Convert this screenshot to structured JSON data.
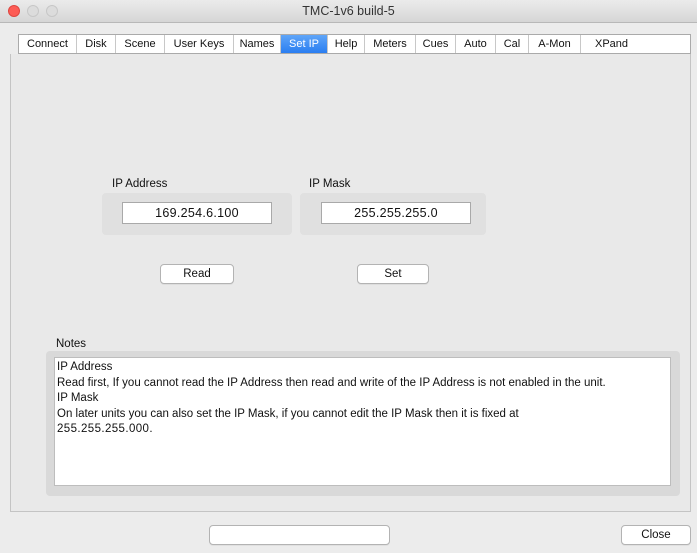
{
  "window": {
    "title": "TMC-1v6 build-5"
  },
  "tabs": [
    {
      "label": "Connect",
      "active": false
    },
    {
      "label": "Disk",
      "active": false
    },
    {
      "label": "Scene",
      "active": false
    },
    {
      "label": "User Keys",
      "active": false
    },
    {
      "label": "Names",
      "active": false
    },
    {
      "label": "Set IP",
      "active": true
    },
    {
      "label": "Help",
      "active": false
    },
    {
      "label": "Meters",
      "active": false
    },
    {
      "label": "Cues",
      "active": false
    },
    {
      "label": "Auto",
      "active": false
    },
    {
      "label": "Cal",
      "active": false
    },
    {
      "label": "A-Mon",
      "active": false
    },
    {
      "label": "XPand",
      "active": false
    }
  ],
  "ip_address": {
    "label": "IP Address",
    "value": "169.254.6.100"
  },
  "ip_mask": {
    "label": "IP Mask",
    "value": "255.255.255.0"
  },
  "buttons": {
    "read": "Read",
    "set": "Set",
    "close": "Close"
  },
  "status_field": {
    "value": ""
  },
  "notes": {
    "label": "Notes",
    "lines": [
      "IP Address",
      "Read first, If you cannot read the IP Address then read and write of the IP Address is not enabled in the unit.",
      "IP Mask",
      "On later units you can also set the IP Mask, if you cannot edit the IP Mask then it is fixed at",
      "255.255.255.000."
    ]
  },
  "colors": {
    "active_tab": "#2a7ef1",
    "close_light": "#fd5c55"
  }
}
